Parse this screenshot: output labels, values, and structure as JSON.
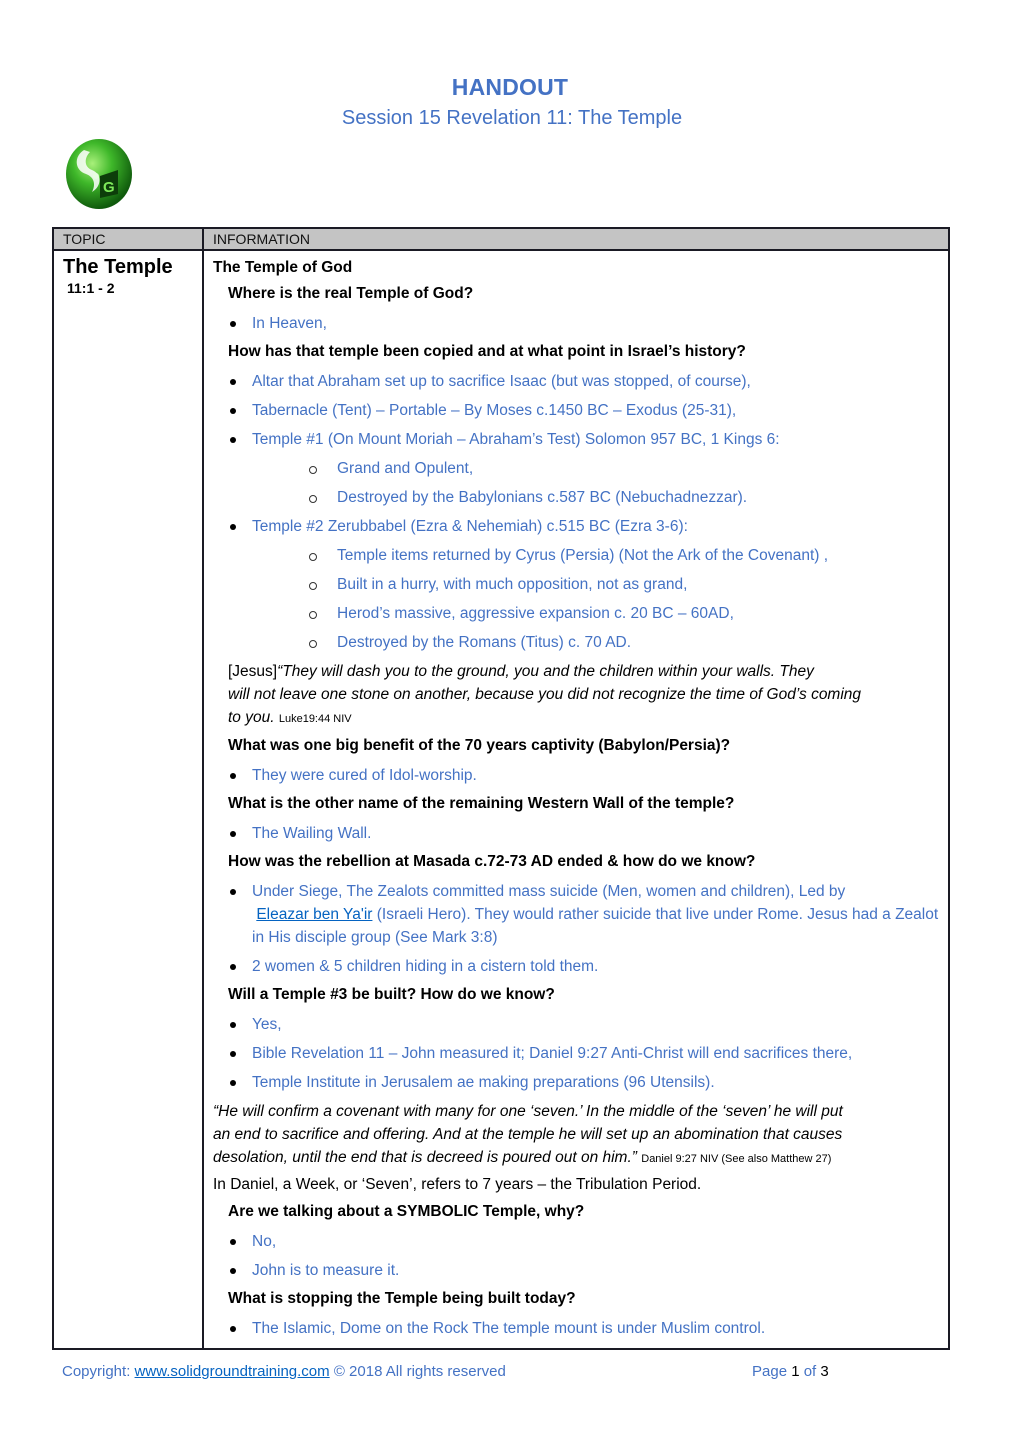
{
  "header": {
    "title": "HANDOUT",
    "subtitle": "Session 15 Revelation 11: The Temple",
    "logo_icon": "solid-ground-logo-icon"
  },
  "colors": {
    "accent_blue": "#4472c4",
    "link_blue": "#0563c1",
    "table_header_bg": "#c4c4c4"
  },
  "table": {
    "headers": [
      "TOPIC",
      "INFORMATION"
    ],
    "topic": {
      "title": "The Temple",
      "reference": "11:1 - 2"
    },
    "info": {
      "heading": "The Temple of God",
      "q1": "Where is the real Temple of God?",
      "a1": [
        "In Heaven,"
      ],
      "q2": "How has that temple been copied and at what point in Israel’s history?",
      "a2": [
        "Altar that Abraham set up to sacrifice Isaac (but was stopped, of course),",
        "Tabernacle (Tent) – Portable – By Moses c.1450 BC – Exodus (25-31),",
        "Temple #1 (On Mount Moriah – Abraham’s Test) Solomon 957 BC, 1 Kings 6:"
      ],
      "a2_sub": [
        "Grand and Opulent,",
        "Destroyed by the Babylonians c.587 BC (Nebuchadnezzar)."
      ],
      "a2b": "Temple #2 Zerubbabel (Ezra & Nehemiah) c.515 BC (Ezra 3-6):",
      "a2b_sub": [
        "Temple items returned by Cyrus (Persia) (Not the Ark of the Covenant) ,",
        "Built in a hurry, with much opposition, not as grand,",
        "Herod’s massive, aggressive expansion c. 20 BC – 60AD,",
        "Destroyed by the Romans (Titus) c. 70 AD."
      ],
      "quote1_speaker": "[Jesus]",
      "quote1_line1": "“They will dash you to the ground, you and the children within your walls. They",
      "quote1_line2": "will not leave one stone on another, because you did not recognize the time of God’s coming",
      "quote1_line3": "to you.",
      "quote1_ref": "Luke19:44 NIV",
      "q3": "What was one big benefit of the 70 years captivity (Babylon/Persia)?",
      "a3": [
        "They were cured of Idol-worship."
      ],
      "q4": "What is the other name of the remaining Western Wall of the temple?",
      "a4": [
        "The Wailing Wall."
      ],
      "q5": "How was the rebellion at Masada c.72-73 AD ended & how do we know?",
      "a5_1_pre": "Under Siege, The Zealots committed mass suicide (Men, women and children), Led by",
      "a5_1_link": "Eleazar ben Ya'ir",
      "a5_1_post": " (Israeli Hero). They would rather suicide that live under Rome.  Jesus had a Zealot in His disciple group (See Mark 3:8)",
      "a5_2": "2 women & 5 children hiding in a cistern told them.",
      "q6": "Will a Temple #3 be built? How do we know?",
      "a6": [
        "Yes,",
        "Bible Revelation 11 – John measured it; Daniel 9:27 Anti-Christ will end sacrifices there,",
        "Temple Institute in Jerusalem ae making preparations (96 Utensils)."
      ],
      "quote2_line1": "“He will confirm a covenant with many for one ‘seven.’ In the middle of the ‘seven’ he will put",
      "quote2_line2": "an end to sacrifice and offering. And at the temple he will set up an abomination that causes",
      "quote2_line3": "desolation, until the end that is decreed is poured out on him.”",
      "quote2_ref": "Daniel 9:27 NIV (See also Matthew 27)",
      "note": "In Daniel, a Week, or ‘Seven’, refers to 7 years – the Tribulation Period.",
      "q7": "Are we talking about a SYMBOLIC Temple, why?",
      "a7": [
        "No,",
        "John is to measure it."
      ],
      "q8": "What is stopping the Temple being built today?",
      "a8": [
        "The Islamic, Dome on the Rock The temple mount is under Muslim control."
      ]
    }
  },
  "footer": {
    "copyright_prefix": "Copyright: ",
    "link": "www.solidgroundtraining.com",
    "copyright_suffix": " © 2018 All rights reserved",
    "page_label": "Page ",
    "page_current": "1",
    "page_of": " of ",
    "page_total": "3"
  }
}
